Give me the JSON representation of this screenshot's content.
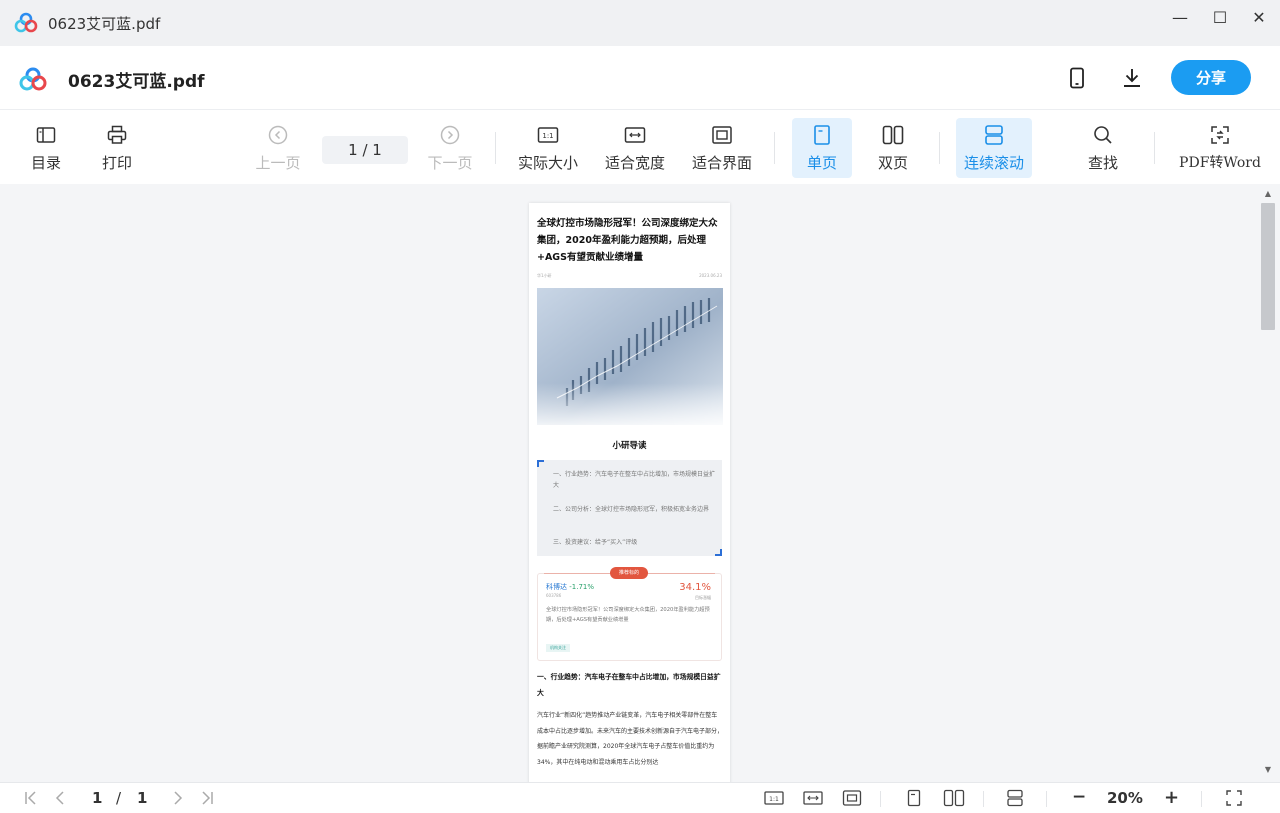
{
  "window": {
    "title": "0623艾可蓝.pdf",
    "minimize": "—",
    "maximize": "☐",
    "close": "✕"
  },
  "header": {
    "doc_title": "0623艾可蓝.pdf",
    "share_label": "分享",
    "icons": [
      "phone-icon",
      "download-icon"
    ]
  },
  "toolbar": {
    "toc": "目录",
    "print": "打印",
    "prev_page": "上一页",
    "page_indicator": "1  /  1",
    "next_page": "下一页",
    "actual_size": "实际大小",
    "fit_width": "适合宽度",
    "fit_page": "适合界面",
    "single_page": "单页",
    "double_page": "双页",
    "continuous_scroll": "连续滚动",
    "find": "查找",
    "pdf_to_word": "PDF转Word",
    "active_modes": [
      "单页",
      "连续滚动"
    ],
    "accent_color": "#1b9cf2"
  },
  "document": {
    "title": "全球灯控市场隐形冠军！公司深度绑定大众集团，2020年盈利能力超预期，后处理+AGS有望贡献业绩增量",
    "meta_left": "华1小研",
    "meta_right": "2023.06.23",
    "lead_heading": "小研导读",
    "lead_items": [
      "一、行业趋势：汽车电子在整车中占比增加，市场规模日益扩大",
      "二、公司分析：全球灯控市场隐形冠军，积极拓宽业务边界",
      "三、投资建议：给予“买入”评级"
    ],
    "card": {
      "tag": "推荐标的",
      "stock_name": "科博达",
      "stock_change": "-1.71%",
      "stock_code": "603786",
      "target_pct": "34.1%",
      "target_label": "目标涨幅",
      "desc": "全球灯控市场隐形冠军！公司深度绑定大众集团，2020年盈利能力超预期，后处理+AGS有望贡献业绩增量",
      "chip": "机构关注"
    },
    "section_heading": "一、行业趋势：汽车电子在整车中占比增加，市场规模日益扩大",
    "body": "汽车行业“新四化”趋势推动产业链变革，汽车电子相关零部件在整车成本中占比逐步增加。未来汽车的主要技术创新源自于汽车电子部分，据前瞻产业研究院测算，2020年全球汽车电子占整车价值比重约为34%，其中在纯电动和混动乘用车占比分别达"
  },
  "statusbar": {
    "current_page": "1",
    "separator": "/",
    "total_pages": "1",
    "zoom_minus": "−",
    "zoom": "20%",
    "zoom_plus": "+"
  }
}
